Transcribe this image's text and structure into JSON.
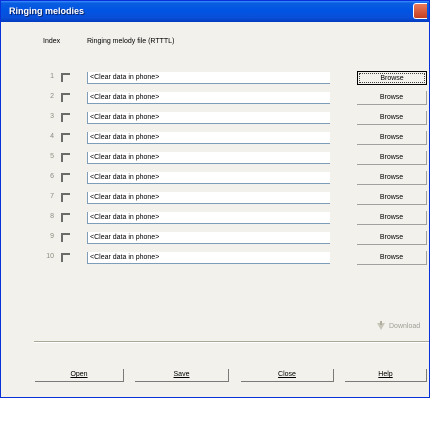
{
  "window": {
    "title": "Ringing melodies"
  },
  "headers": {
    "index": "Index",
    "file": "Ringing melody file (RTTTL)"
  },
  "rows": [
    {
      "index": "1",
      "value": "<Clear data in phone>",
      "browse": "Browse"
    },
    {
      "index": "2",
      "value": "<Clear data in phone>",
      "browse": "Browse"
    },
    {
      "index": "3",
      "value": "<Clear data in phone>",
      "browse": "Browse"
    },
    {
      "index": "4",
      "value": "<Clear data in phone>",
      "browse": "Browse"
    },
    {
      "index": "5",
      "value": "<Clear data in phone>",
      "browse": "Browse"
    },
    {
      "index": "6",
      "value": "<Clear data in phone>",
      "browse": "Browse"
    },
    {
      "index": "7",
      "value": "<Clear data in phone>",
      "browse": "Browse"
    },
    {
      "index": "8",
      "value": "<Clear data in phone>",
      "browse": "Browse"
    },
    {
      "index": "9",
      "value": "<Clear data in phone>",
      "browse": "Browse"
    },
    {
      "index": "10",
      "value": "<Clear data in phone>",
      "browse": "Browse"
    }
  ],
  "download": {
    "label": "Download",
    "enabled": false,
    "icon": "download-icon"
  },
  "buttons": {
    "open": "Open",
    "save": "Save",
    "close": "Close",
    "help": "Help"
  },
  "colors": {
    "titlebar": "#0054e3",
    "window_bg": "#ece9d8",
    "disabled_text": "#a09f96"
  }
}
